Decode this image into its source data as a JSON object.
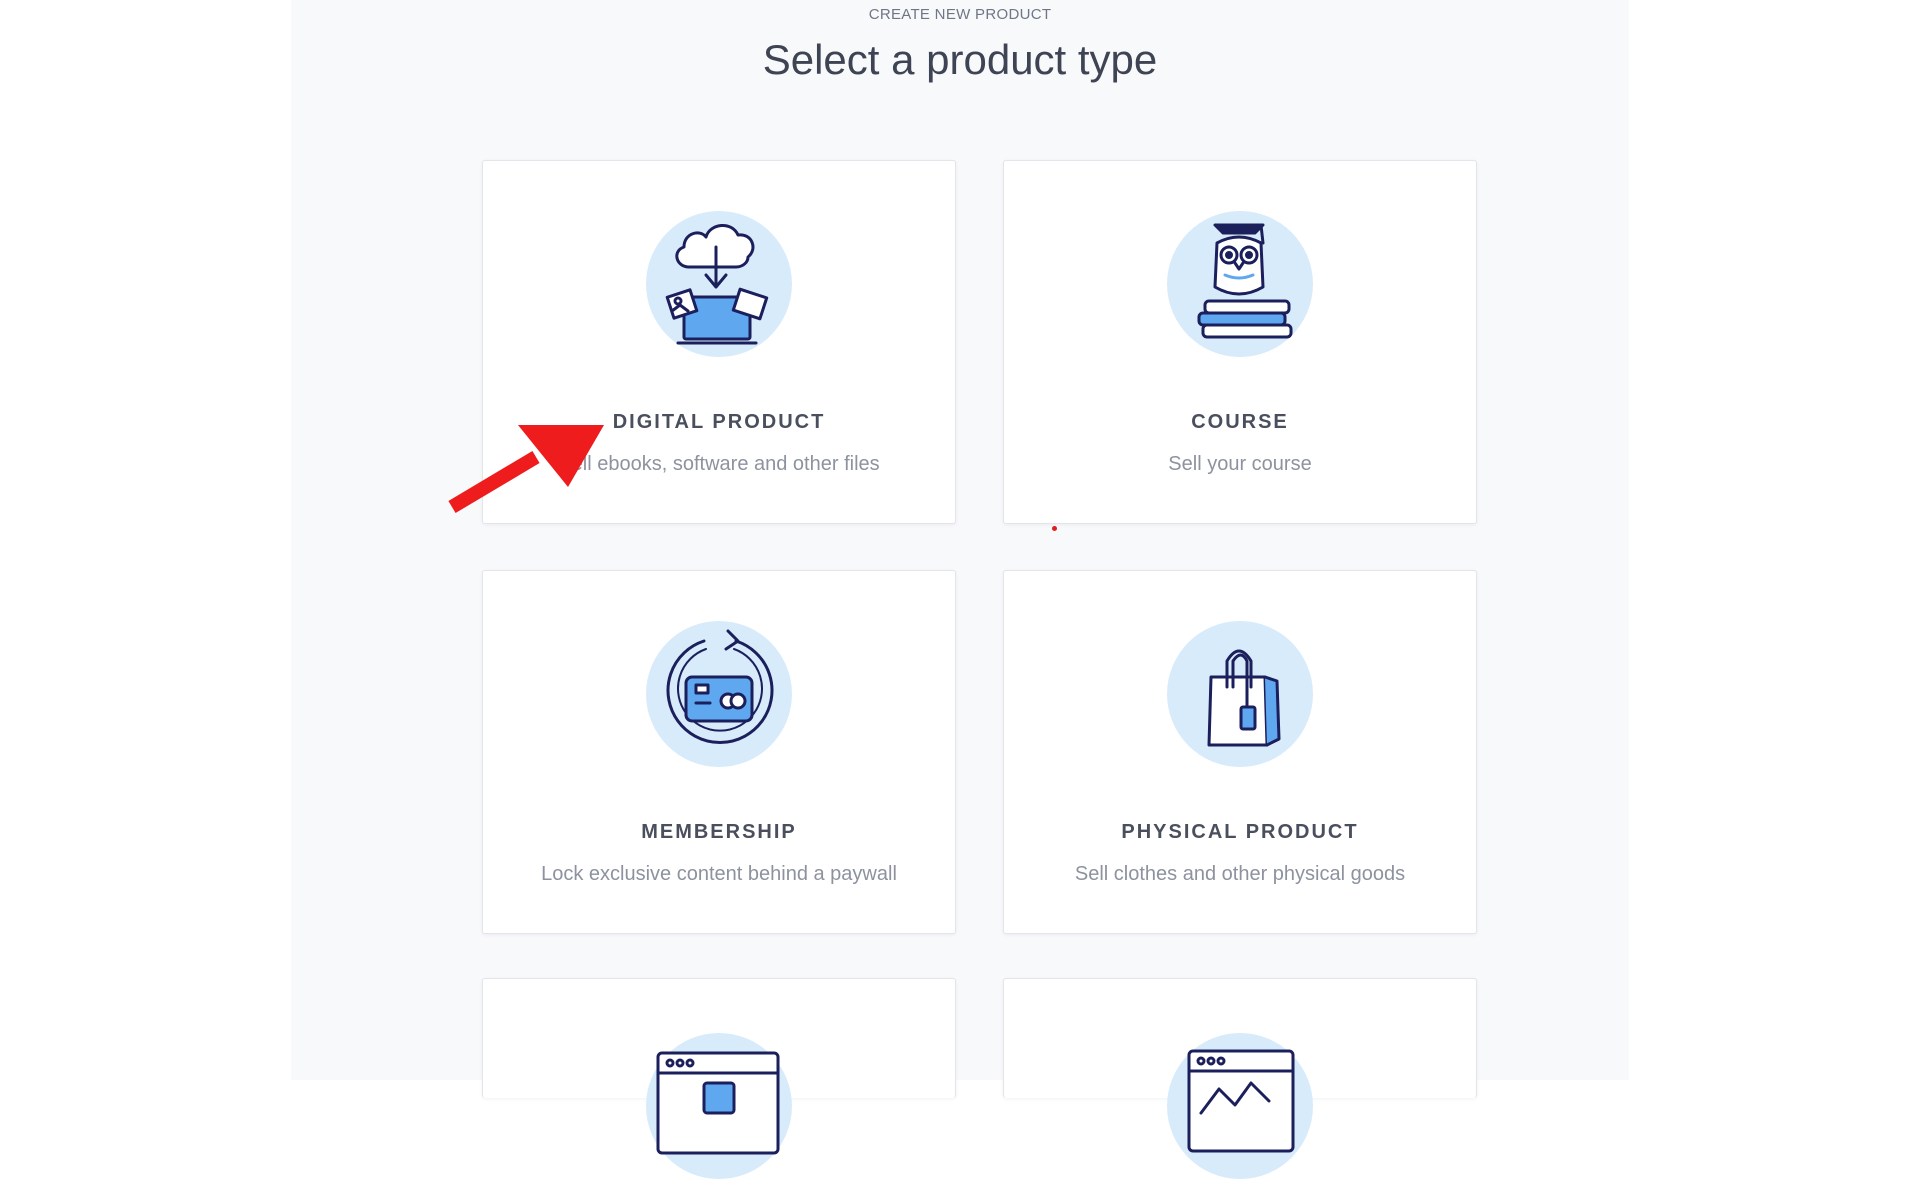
{
  "header": {
    "eyebrow": "CREATE NEW PRODUCT",
    "title": "Select a product type"
  },
  "cards": [
    {
      "title": "DIGITAL PRODUCT",
      "description": "Sell ebooks, software and other files",
      "icon": "cloud-download-laptop-icon"
    },
    {
      "title": "COURSE",
      "description": "Sell your course",
      "icon": "owl-books-icon"
    },
    {
      "title": "MEMBERSHIP",
      "description": "Lock exclusive content behind a paywall",
      "icon": "recurring-credit-card-icon"
    },
    {
      "title": "PHYSICAL PRODUCT",
      "description": "Sell clothes and other physical goods",
      "icon": "shopping-bag-icon"
    }
  ],
  "partial_cards": [
    {
      "icon": "browser-window-icon"
    },
    {
      "icon": "browser-chart-icon"
    }
  ],
  "colors": {
    "icon_circle": "#d8ebfb",
    "icon_stroke": "#1b1f5c",
    "icon_fill": "#5fa8f0",
    "annotation_arrow": "#ee1c1c"
  }
}
